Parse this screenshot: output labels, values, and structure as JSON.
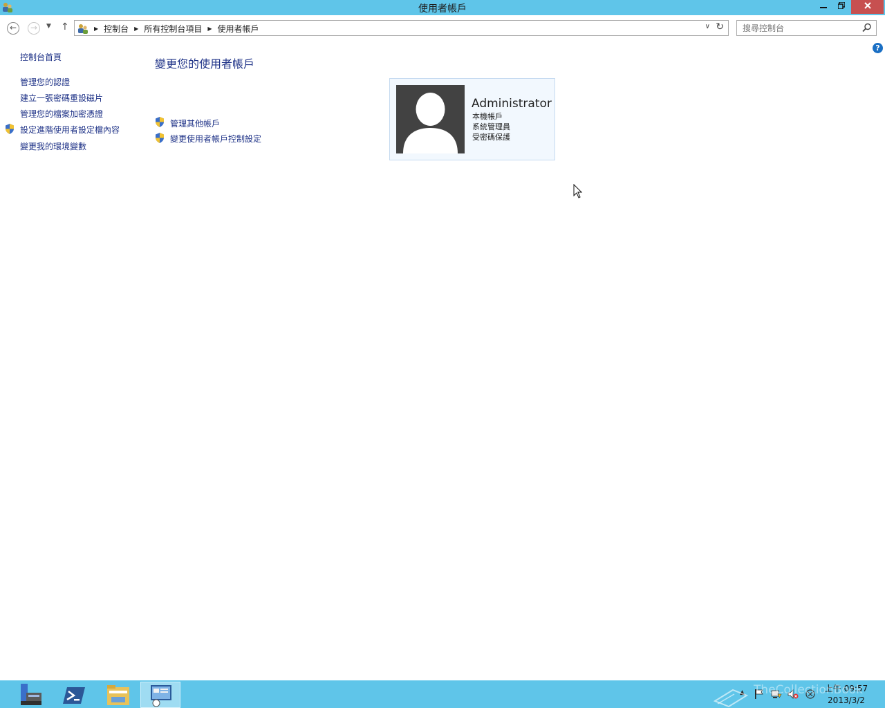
{
  "window": {
    "title": "使用者帳戶",
    "minimize_icon": "minimize-icon",
    "maximize_icon": "restore-icon",
    "close_icon": "close-icon"
  },
  "navigation": {
    "breadcrumb": [
      "控制台",
      "所有控制台項目",
      "使用者帳戶"
    ],
    "search_placeholder": "搜尋控制台"
  },
  "left_pane": {
    "home_link": "控制台首頁",
    "links": [
      {
        "label": "管理您的認證",
        "icon": ""
      },
      {
        "label": "建立一張密碼重設磁片",
        "icon": ""
      },
      {
        "label": "管理您的檔案加密憑證",
        "icon": ""
      },
      {
        "label": "設定進階使用者設定檔內容",
        "icon": "uac-shield-icon"
      },
      {
        "label": "變更我的環境變數",
        "icon": ""
      }
    ]
  },
  "main": {
    "title": "變更您的使用者帳戶",
    "links": [
      {
        "label": "管理其他帳戶",
        "icon": "uac-shield-icon"
      },
      {
        "label": "變更使用者帳戶控制設定",
        "icon": "uac-shield-icon"
      }
    ],
    "account": {
      "name": "Administrator",
      "details": [
        "本機帳戶",
        "系統管理員",
        "受密碼保護"
      ]
    }
  },
  "taskbar": {
    "apps": [
      "server-manager-icon",
      "powershell-icon",
      "file-explorer-icon",
      "control-panel-icon"
    ],
    "active_app": "control-panel-icon",
    "clock": {
      "time": "上午 09:57",
      "date": "2013/3/2"
    },
    "watermark": "TheCollectionBook"
  },
  "colors": {
    "titlebar": "#5fc5e9",
    "link": "#1e3287",
    "close_button": "#c75050"
  }
}
